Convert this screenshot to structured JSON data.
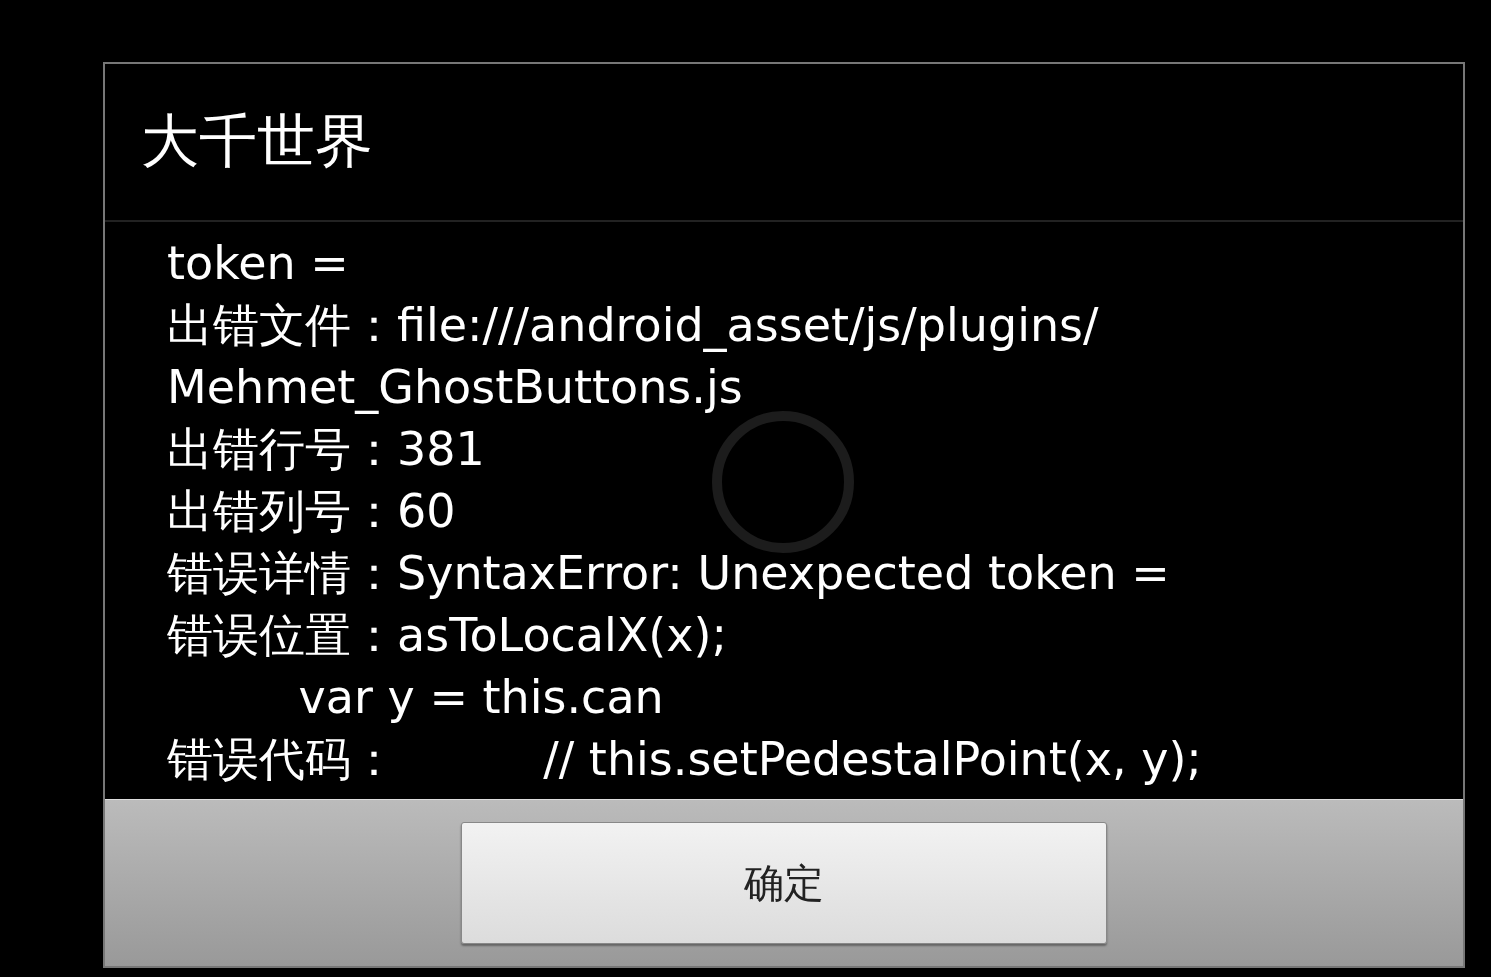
{
  "dialog": {
    "title": "大千世界",
    "lines": [
      "token =",
      "出错文件：file:///android_asset/js/plugins/",
      "Mehmet_GhostButtons.js",
      "出错行号：381",
      "出错列号：60",
      "错误详情：SyntaxError: Unexpected token =",
      "错误位置：asToLocalX(x);",
      "         var y = this.can",
      "错误代码：          // this.setPedestalPoint(x, y);"
    ],
    "buttons": [
      "确定"
    ]
  }
}
